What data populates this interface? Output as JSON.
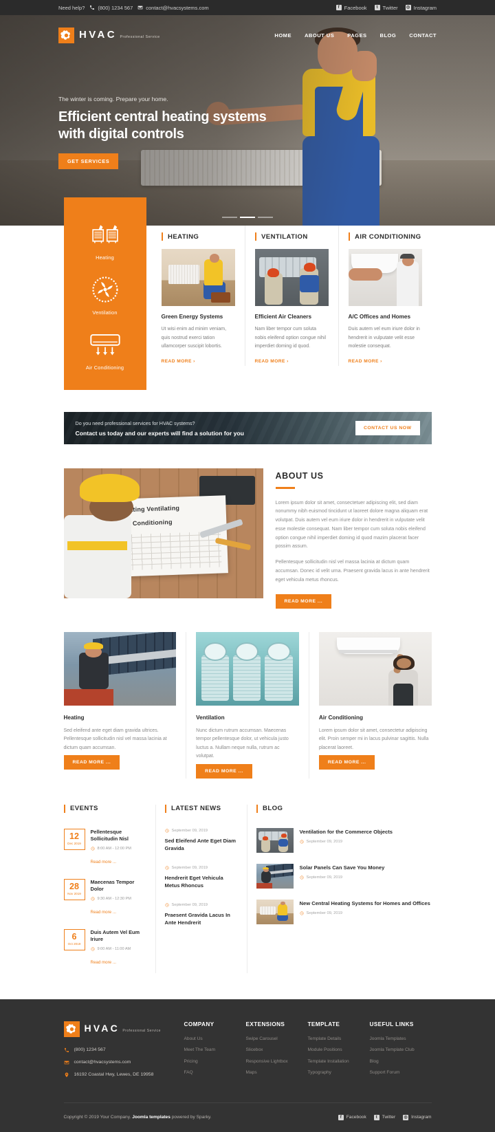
{
  "topbar": {
    "help_label": "Need help?",
    "phone": "(800) 1234 567",
    "email": "contact@hvacsystems.com",
    "social": [
      {
        "name": "Facebook",
        "glyph": "f"
      },
      {
        "name": "Twitter",
        "glyph": "t"
      },
      {
        "name": "Instagram",
        "glyph": "◎"
      }
    ]
  },
  "brand": {
    "name": "HVAC",
    "tagline": "Professional Service"
  },
  "nav": [
    {
      "label": "HOME"
    },
    {
      "label": "ABOUT US"
    },
    {
      "label": "PAGES"
    },
    {
      "label": "BLOG"
    },
    {
      "label": "CONTACT"
    }
  ],
  "hero": {
    "subtitle": "The winter is coming. Prepare your home.",
    "title": "Efficient central heating systems with digital controls",
    "button": "GET SERVICES",
    "slides": 3,
    "active_slide": 1
  },
  "service_panel": [
    {
      "label": "Heating",
      "icon": "radiator-icon"
    },
    {
      "label": "Ventilation",
      "icon": "fan-icon"
    },
    {
      "label": "Air Conditioning",
      "icon": "air-conditioner-icon"
    }
  ],
  "service_cards": [
    {
      "category": "HEATING",
      "title": "Green Energy Systems",
      "text": "Ut wisi enim ad minim veniam, quis nostrud exerci tation ullamcorper suscipit lobortis.",
      "link": "READ MORE"
    },
    {
      "category": "VENTILATION",
      "title": "Efficient Air Cleaners",
      "text": "Nam liber tempor cum soluta nobis eleifend option congue nihil imperdiet doming id quod.",
      "link": "READ MORE"
    },
    {
      "category": "AIR CONDITIONING",
      "title": "A/C Offices and Homes",
      "text": "Duis autem vel eum iriure dolor in hendrerit in vulputate velit esse molestie consequat.",
      "link": "READ MORE"
    }
  ],
  "cta": {
    "line1": "Do you need professional services for HVAC systems?",
    "line2": "Contact us today and our experts will find a solution for you",
    "button": "CONTACT US NOW"
  },
  "about": {
    "title": "ABOUT US",
    "paragraph1": "Lorem ipsum dolor sit amet, consectetuer adipiscing elit, sed diam nonummy nibh euismod tincidunt ut laoreet dolore magna aliquam erat volutpat. Duis autem vel eum iriure dolor in hendrerit in vulputate velit esse molestie consequat. Nam liber tempor cum soluta nobis eleifend option congue nihil imperdiet doming id quod mazim placerat facer possim assum.",
    "paragraph2": "Pellentesque sollicitudin nisl vel massa lacinia at dictum quam accumsan. Donec id velit urna. Praesent gravida lacus in ante hendrerit eget vehicula metus rhoncus.",
    "button": "READ MORE ...",
    "image_caption_line1": "Heating  Ventilating",
    "image_caption_line2": "Air Conditioning"
  },
  "features": [
    {
      "title": "Heating",
      "text": "Sed eleifend ante eget diam gravida ultrices. Pellentesque sollicitudin nisl vel massa lacinia at dictum quam accumsan.",
      "button": "READ MORE ..."
    },
    {
      "title": "Ventilation",
      "text": "Nunc dictum rutrum accumsan. Maecenas tempor pellentesque dolor, ut vehicula justo luctus a. Nullam neque nulla, rutrum ac volutpat.",
      "button": "READ MORE ..."
    },
    {
      "title": "Air Conditioning",
      "text": "Lorem ipsum dolor sit amet, consectetur adipiscing elit. Proin semper mi in lacus pulvinar sagittis. Nulla placerat laoreet.",
      "button": "READ MORE ..."
    }
  ],
  "events": {
    "title": "EVENTS",
    "items": [
      {
        "day": "12",
        "month": "Dec 2019",
        "title": "Pellentesque Sollicitudin Nisl",
        "time": "8:00 AM - 12:00 PM",
        "link": "Read more ..."
      },
      {
        "day": "28",
        "month": "Nov 2019",
        "title": "Maecenas Tempor Dolor",
        "time": "9:30 AM - 12:30 PM",
        "link": "Read more ..."
      },
      {
        "day": "6",
        "month": "Oct 2019",
        "title": "Duis Autem Vel Eum Iriure",
        "time": "9:00 AM - 11:00 AM",
        "link": "Read more ..."
      }
    ]
  },
  "news": {
    "title": "LATEST NEWS",
    "items": [
      {
        "date": "September 09, 2019",
        "title": "Sed Eleifend Ante Eget Diam Gravida"
      },
      {
        "date": "September 09, 2019",
        "title": "Hendrerit Eget Vehicula Metus Rhoncus"
      },
      {
        "date": "September 09, 2019",
        "title": "Praesent Gravida Lacus In Ante Hendrerit"
      }
    ]
  },
  "blog": {
    "title": "BLOG",
    "items": [
      {
        "title": "Ventilation for the Commerce Objects",
        "date": "September 09, 2019"
      },
      {
        "title": "Solar Panels Can Save You Money",
        "date": "September 09, 2019"
      },
      {
        "title": "New Central Heating Systems for Homes and Offices",
        "date": "September 09, 2019"
      }
    ]
  },
  "footer": {
    "phone": "(800) 1234 567",
    "email": "contact@hvacsystems.com",
    "address": "16192 Coastal Hwy, Lewes, DE 19958",
    "columns": [
      {
        "title": "COMPANY",
        "links": [
          "About Us",
          "Meet The Team",
          "Pricing",
          "FAQ"
        ]
      },
      {
        "title": "EXTENSIONS",
        "links": [
          "Swipe Carousel",
          "Slicebox",
          "Responsive Lightbox",
          "Maps"
        ]
      },
      {
        "title": "TEMPLATE",
        "links": [
          "Template Details",
          "Module Positions",
          "Template Installation",
          "Typography"
        ]
      },
      {
        "title": "USEFUL LINKS",
        "links": [
          "Joomla Templates",
          "Joomla Template Club",
          "Blog",
          "Support Forum"
        ]
      }
    ],
    "copyright_pre": "Copyright © 2019 Your Company.",
    "copyright_link": "Joomla templates",
    "copyright_post": "powered by Sparky.",
    "social": [
      {
        "name": "Facebook",
        "glyph": "f"
      },
      {
        "name": "Twitter",
        "glyph": "t"
      },
      {
        "name": "Instagram",
        "glyph": "◎"
      }
    ]
  },
  "colors": {
    "accent": "#ef7f1a",
    "dark": "#333333",
    "topbar": "#2b2b2b"
  }
}
